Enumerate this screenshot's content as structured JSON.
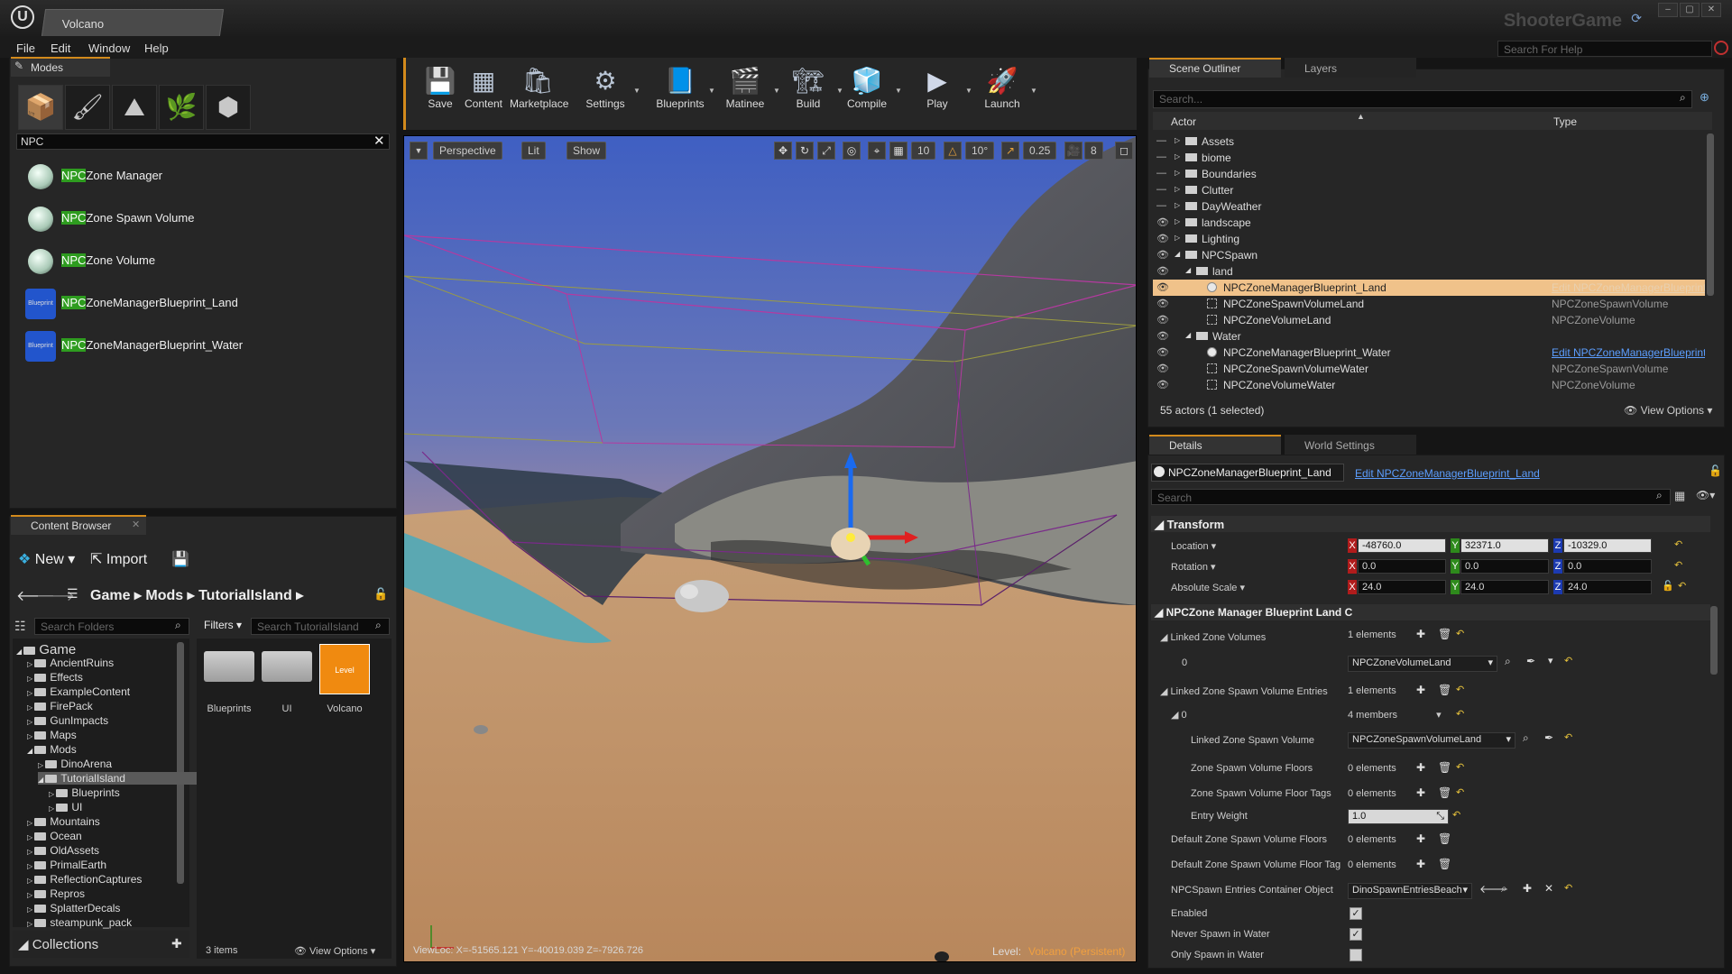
{
  "window": {
    "doc_tab": "Volcano",
    "app_name": "ShooterGame"
  },
  "menu": {
    "items": [
      "File",
      "Edit",
      "Window",
      "Help"
    ],
    "help_search_placeholder": "Search For Help"
  },
  "modes": {
    "tab": "Modes",
    "search_value": "NPC",
    "results": [
      {
        "highlight": "NPC",
        "rest": "Zone Manager",
        "thumb": "sphere"
      },
      {
        "highlight": "NPC",
        "rest": "Zone Spawn Volume",
        "thumb": "sphere"
      },
      {
        "highlight": "NPC",
        "rest": "Zone Volume",
        "thumb": "sphere"
      },
      {
        "highlight": "NPC",
        "rest": "ZoneManagerBlueprint_Land",
        "thumb": "Blueprint"
      },
      {
        "highlight": "NPC",
        "rest": "ZoneManagerBlueprint_Water",
        "thumb": "Blueprint"
      }
    ]
  },
  "toolbar": {
    "buttons": [
      "Save",
      "Content",
      "Marketplace",
      "Settings",
      "Blueprints",
      "Matinee",
      "Build",
      "Compile",
      "Play",
      "Launch"
    ]
  },
  "viewport": {
    "perspective": "Perspective",
    "lit": "Lit",
    "show": "Show",
    "grid_snap": "10",
    "rot_snap": "10°",
    "scale_snap": "0.25",
    "cam_speed": "8",
    "viewloc": "ViewLoc: X=-51565.121 Y=-40019.039 Z=-7926.726",
    "level_label": "Level:",
    "level_name": "Volcano (Persistent)"
  },
  "content_browser": {
    "tab": "Content Browser",
    "new_label": "New",
    "import_label": "Import",
    "breadcrumb": [
      "Game",
      "Mods",
      "TutorialIsland"
    ],
    "search_folders_placeholder": "Search Folders",
    "filters_label": "Filters",
    "search_assets_placeholder": "Search TutorialIsland",
    "tree": [
      {
        "label": "Game",
        "level": 0,
        "expanded": true
      },
      {
        "label": "AncientRuins",
        "level": 1
      },
      {
        "label": "Effects",
        "level": 1
      },
      {
        "label": "ExampleContent",
        "level": 1
      },
      {
        "label": "FirePack",
        "level": 1
      },
      {
        "label": "GunImpacts",
        "level": 1
      },
      {
        "label": "Maps",
        "level": 1
      },
      {
        "label": "Mods",
        "level": 1,
        "expanded": true
      },
      {
        "label": "DinoArena",
        "level": 2
      },
      {
        "label": "TutorialIsland",
        "level": 2,
        "expanded": true,
        "selected": true
      },
      {
        "label": "Blueprints",
        "level": 3
      },
      {
        "label": "UI",
        "level": 3
      },
      {
        "label": "Mountains",
        "level": 1
      },
      {
        "label": "Ocean",
        "level": 1
      },
      {
        "label": "OldAssets",
        "level": 1
      },
      {
        "label": "PrimalEarth",
        "level": 1
      },
      {
        "label": "ReflectionCaptures",
        "level": 1
      },
      {
        "label": "Repros",
        "level": 1
      },
      {
        "label": "SplatterDecals",
        "level": 1
      },
      {
        "label": "steampunk_pack",
        "level": 1
      }
    ],
    "assets": [
      {
        "label": "Blueprints",
        "kind": "folder"
      },
      {
        "label": "UI",
        "kind": "folder"
      },
      {
        "label": "Volcano",
        "kind": "level",
        "badge": "Level"
      }
    ],
    "collections_label": "Collections",
    "items_count": "3 items",
    "view_options": "View Options"
  },
  "outliner": {
    "tab": "Scene Outliner",
    "tab2": "Layers",
    "search_placeholder": "Search...",
    "col_actor": "Actor",
    "col_type": "Type",
    "rows": [
      {
        "label": "Assets",
        "indent": 0,
        "kind": "folder",
        "arrow": "▷",
        "eye": false,
        "type": ""
      },
      {
        "label": "biome",
        "indent": 0,
        "kind": "folder",
        "arrow": "▷",
        "eye": false,
        "type": ""
      },
      {
        "label": "Boundaries",
        "indent": 0,
        "kind": "folder",
        "arrow": "▷",
        "eye": false,
        "type": ""
      },
      {
        "label": "Clutter",
        "indent": 0,
        "kind": "folder",
        "arrow": "▷",
        "eye": false,
        "type": ""
      },
      {
        "label": "DayWeather",
        "indent": 0,
        "kind": "folder",
        "arrow": "▷",
        "eye": false,
        "type": ""
      },
      {
        "label": "landscape",
        "indent": 0,
        "kind": "folder",
        "arrow": "▷",
        "eye": true,
        "type": ""
      },
      {
        "label": "Lighting",
        "indent": 0,
        "kind": "folder",
        "arrow": "▷",
        "eye": true,
        "type": ""
      },
      {
        "label": "NPCSpawn",
        "indent": 0,
        "kind": "folder",
        "arrow": "◢",
        "eye": true,
        "type": ""
      },
      {
        "label": "land",
        "indent": 1,
        "kind": "folder",
        "arrow": "◢",
        "eye": true,
        "type": ""
      },
      {
        "label": "NPCZoneManagerBlueprint_Land",
        "indent": 2,
        "kind": "actor",
        "arrow": "",
        "eye": true,
        "type": "Edit NPCZoneManagerBlueprint_Land",
        "selected": true,
        "type_link": true
      },
      {
        "label": "NPCZoneSpawnVolumeLand",
        "indent": 2,
        "kind": "volume",
        "arrow": "",
        "eye": true,
        "type": "NPCZoneSpawnVolume"
      },
      {
        "label": "NPCZoneVolumeLand",
        "indent": 2,
        "kind": "volume",
        "arrow": "",
        "eye": true,
        "type": "NPCZoneVolume"
      },
      {
        "label": "Water",
        "indent": 1,
        "kind": "folder",
        "arrow": "◢",
        "eye": true,
        "type": ""
      },
      {
        "label": "NPCZoneManagerBlueprint_Water",
        "indent": 2,
        "kind": "actor",
        "arrow": "",
        "eye": true,
        "type": "Edit NPCZoneManagerBlueprint_Water",
        "type_link": true
      },
      {
        "label": "NPCZoneSpawnVolumeWater",
        "indent": 2,
        "kind": "volume",
        "arrow": "",
        "eye": true,
        "type": "NPCZoneSpawnVolume"
      },
      {
        "label": "NPCZoneVolumeWater",
        "indent": 2,
        "kind": "volume",
        "arrow": "",
        "eye": true,
        "type": "NPCZoneVolume"
      }
    ],
    "status": "55 actors (1 selected)",
    "view_options": "View Options"
  },
  "details": {
    "tab": "Details",
    "tab2": "World Settings",
    "object_name": "NPCZoneManagerBlueprint_Land",
    "edit_link": "Edit NPCZoneManagerBlueprint_Land",
    "search_placeholder": "Search",
    "transform_header": "Transform",
    "location_label": "Location",
    "rotation_label": "Rotation",
    "scale_label": "Absolute Scale",
    "location": [
      "-48760.0",
      "32371.0",
      "-10329.0"
    ],
    "rotation": [
      "0.0",
      "0.0",
      "0.0"
    ],
    "scale": [
      "24.0",
      "24.0",
      "24.0"
    ],
    "axis_letters": [
      "X",
      "Y",
      "Z"
    ],
    "section_header": "NPCZone Manager Blueprint Land C",
    "linked_zone_volumes": "Linked Zone Volumes",
    "linked_zone_volumes_val": "1 elements",
    "index0": "0",
    "zone_volume_select": "NPCZoneVolumeLand",
    "linked_spawn_entries": "Linked Zone Spawn Volume Entries",
    "linked_spawn_entries_val": "1 elements",
    "entry0": "0",
    "members_select": "4 members",
    "linked_spawn_volume": "Linked Zone Spawn Volume",
    "spawn_volume_select": "NPCZoneSpawnVolumeLand",
    "zone_floors": "Zone Spawn Volume Floors",
    "zone_floors_val": "0 elements",
    "zone_floor_tags": "Zone Spawn Volume Floor Tags",
    "zone_floor_tags_val": "0 elements",
    "entry_weight": "Entry Weight",
    "entry_weight_val": "1.0",
    "default_floors": "Default Zone Spawn Volume Floors",
    "default_floors_val": "0 elements",
    "default_floor_tags": "Default Zone Spawn Volume Floor Tag",
    "default_floor_tags_val": "0 elements",
    "container_obj": "NPCSpawn Entries Container Object",
    "container_select": "DinoSpawnEntriesBeach",
    "enabled": "Enabled",
    "never_spawn_water": "Never Spawn in Water",
    "only_spawn_water": "Only Spawn in Water",
    "enabled_checked": true,
    "never_checked": true,
    "only_checked": false
  },
  "colors": {
    "accent": "#d28a1c",
    "selection": "#f0c28a",
    "highlight": "#2e9c1f",
    "link": "#5c9eff"
  }
}
